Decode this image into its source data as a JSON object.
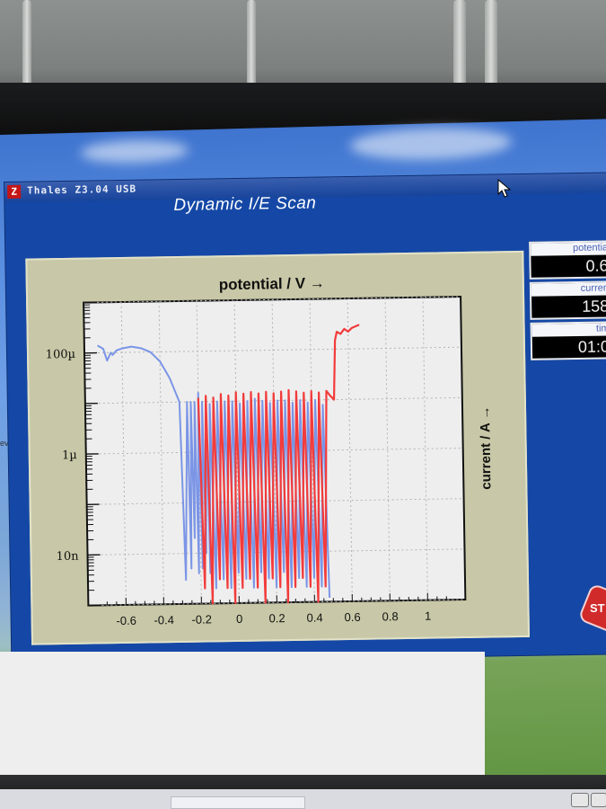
{
  "window": {
    "app_title": "Thales Z3.04 USB",
    "icon_letter": "Z",
    "view_title": "Dynamic I/E Scan"
  },
  "readouts": [
    {
      "label": "potentia",
      "value": "0.6"
    },
    {
      "label": "curren",
      "value": "158"
    },
    {
      "label": "tim",
      "value": "01:0"
    }
  ],
  "stop_button": {
    "label": "ST"
  },
  "chart_data": {
    "type": "line",
    "title": "potential / V →",
    "xlabel": "",
    "ylabel": "current / A →",
    "xlim": [
      -0.8,
      1.2
    ],
    "ylim": [
      1e-09,
      0.001
    ],
    "yscale": "log",
    "grid": true,
    "x_ticks": [
      "-0.6",
      "-0.4",
      "-0.2",
      "0",
      "0.2",
      "0.4",
      "0.6",
      "0.8",
      "1"
    ],
    "y_ticks": [
      "100µ",
      "1µ",
      "10n"
    ],
    "colors": {
      "forward": "#7b95e6",
      "reverse": "#f23b3b"
    },
    "series": [
      {
        "x": [
          -0.73,
          -0.7,
          -0.68,
          -0.66,
          -0.65,
          -0.63,
          -0.6,
          -0.55,
          -0.5,
          -0.45,
          -0.4,
          -0.35,
          -0.3,
          -0.28,
          -0.26,
          -0.25,
          -0.24,
          -0.23,
          -0.22,
          -0.21,
          -0.2,
          -0.19,
          -0.18,
          -0.17,
          -0.16,
          -0.15,
          -0.14,
          -0.12,
          -0.1,
          -0.08,
          -0.06,
          -0.04,
          -0.02,
          0.0,
          0.02,
          0.04,
          0.06,
          0.08,
          0.1,
          0.12,
          0.14,
          0.16,
          0.18,
          0.2,
          0.22,
          0.24,
          0.26,
          0.28,
          0.3,
          0.32,
          0.34,
          0.36,
          0.38,
          0.4,
          0.42,
          0.44,
          0.46,
          0.48
        ],
        "y": [
          0.00014,
          0.00012,
          7e-05,
          0.0001,
          9e-05,
          0.00011,
          0.00012,
          0.00013,
          0.00012,
          0.0001,
          6.5e-05,
          3e-05,
          1e-05,
          3e-09,
          1e-05,
          5e-09,
          1e-05,
          2e-08,
          1e-05,
          4e-09,
          1.5e-05,
          5e-09,
          1e-05,
          1e-08,
          1.1e-05,
          4e-09,
          9e-06,
          2e-09,
          1e-05,
          3e-09,
          1e-05,
          2e-09,
          1e-05,
          4e-09,
          9e-06,
          3e-09,
          1e-05,
          2e-09,
          1.1e-05,
          4e-09,
          1e-05,
          3e-09,
          9e-06,
          2e-09,
          1e-05,
          4e-09,
          1e-05,
          2e-09,
          9e-06,
          3e-09,
          1e-05,
          2e-09,
          9e-06,
          3e-09,
          1e-05,
          2e-09,
          8e-06,
          1.2e-09
        ]
      },
      {
        "x": [
          -0.2,
          -0.18,
          -0.16,
          -0.14,
          -0.12,
          -0.1,
          -0.08,
          -0.06,
          -0.04,
          -0.02,
          0.0,
          0.02,
          0.04,
          0.06,
          0.08,
          0.1,
          0.12,
          0.14,
          0.16,
          0.18,
          0.2,
          0.22,
          0.24,
          0.26,
          0.28,
          0.3,
          0.32,
          0.34,
          0.36,
          0.38,
          0.4,
          0.42,
          0.44,
          0.46,
          0.48,
          0.5,
          0.52,
          0.53,
          0.54,
          0.56,
          0.58,
          0.6,
          0.62,
          0.64,
          0.66
        ],
        "y": [
          1.2e-05,
          2e-09,
          1.3e-05,
          1e-09,
          1.2e-05,
          3e-09,
          1.4e-05,
          2e-09,
          1.3e-05,
          1e-09,
          1.5e-05,
          2e-09,
          1.4e-05,
          3e-09,
          1.5e-05,
          2e-09,
          1.4e-05,
          1e-09,
          1.5e-05,
          3e-09,
          1.4e-05,
          2e-09,
          1.5e-05,
          1e-09,
          1.6e-05,
          2e-09,
          1.5e-05,
          3e-09,
          1.4e-05,
          2e-09,
          1.5e-05,
          1e-09,
          1.4e-05,
          2e-09,
          1.5e-05,
          1.2e-05,
          1e-05,
          0.00015,
          0.00022,
          0.0002,
          0.00025,
          0.00022,
          0.00026,
          0.00028,
          0.0003
        ]
      }
    ]
  }
}
